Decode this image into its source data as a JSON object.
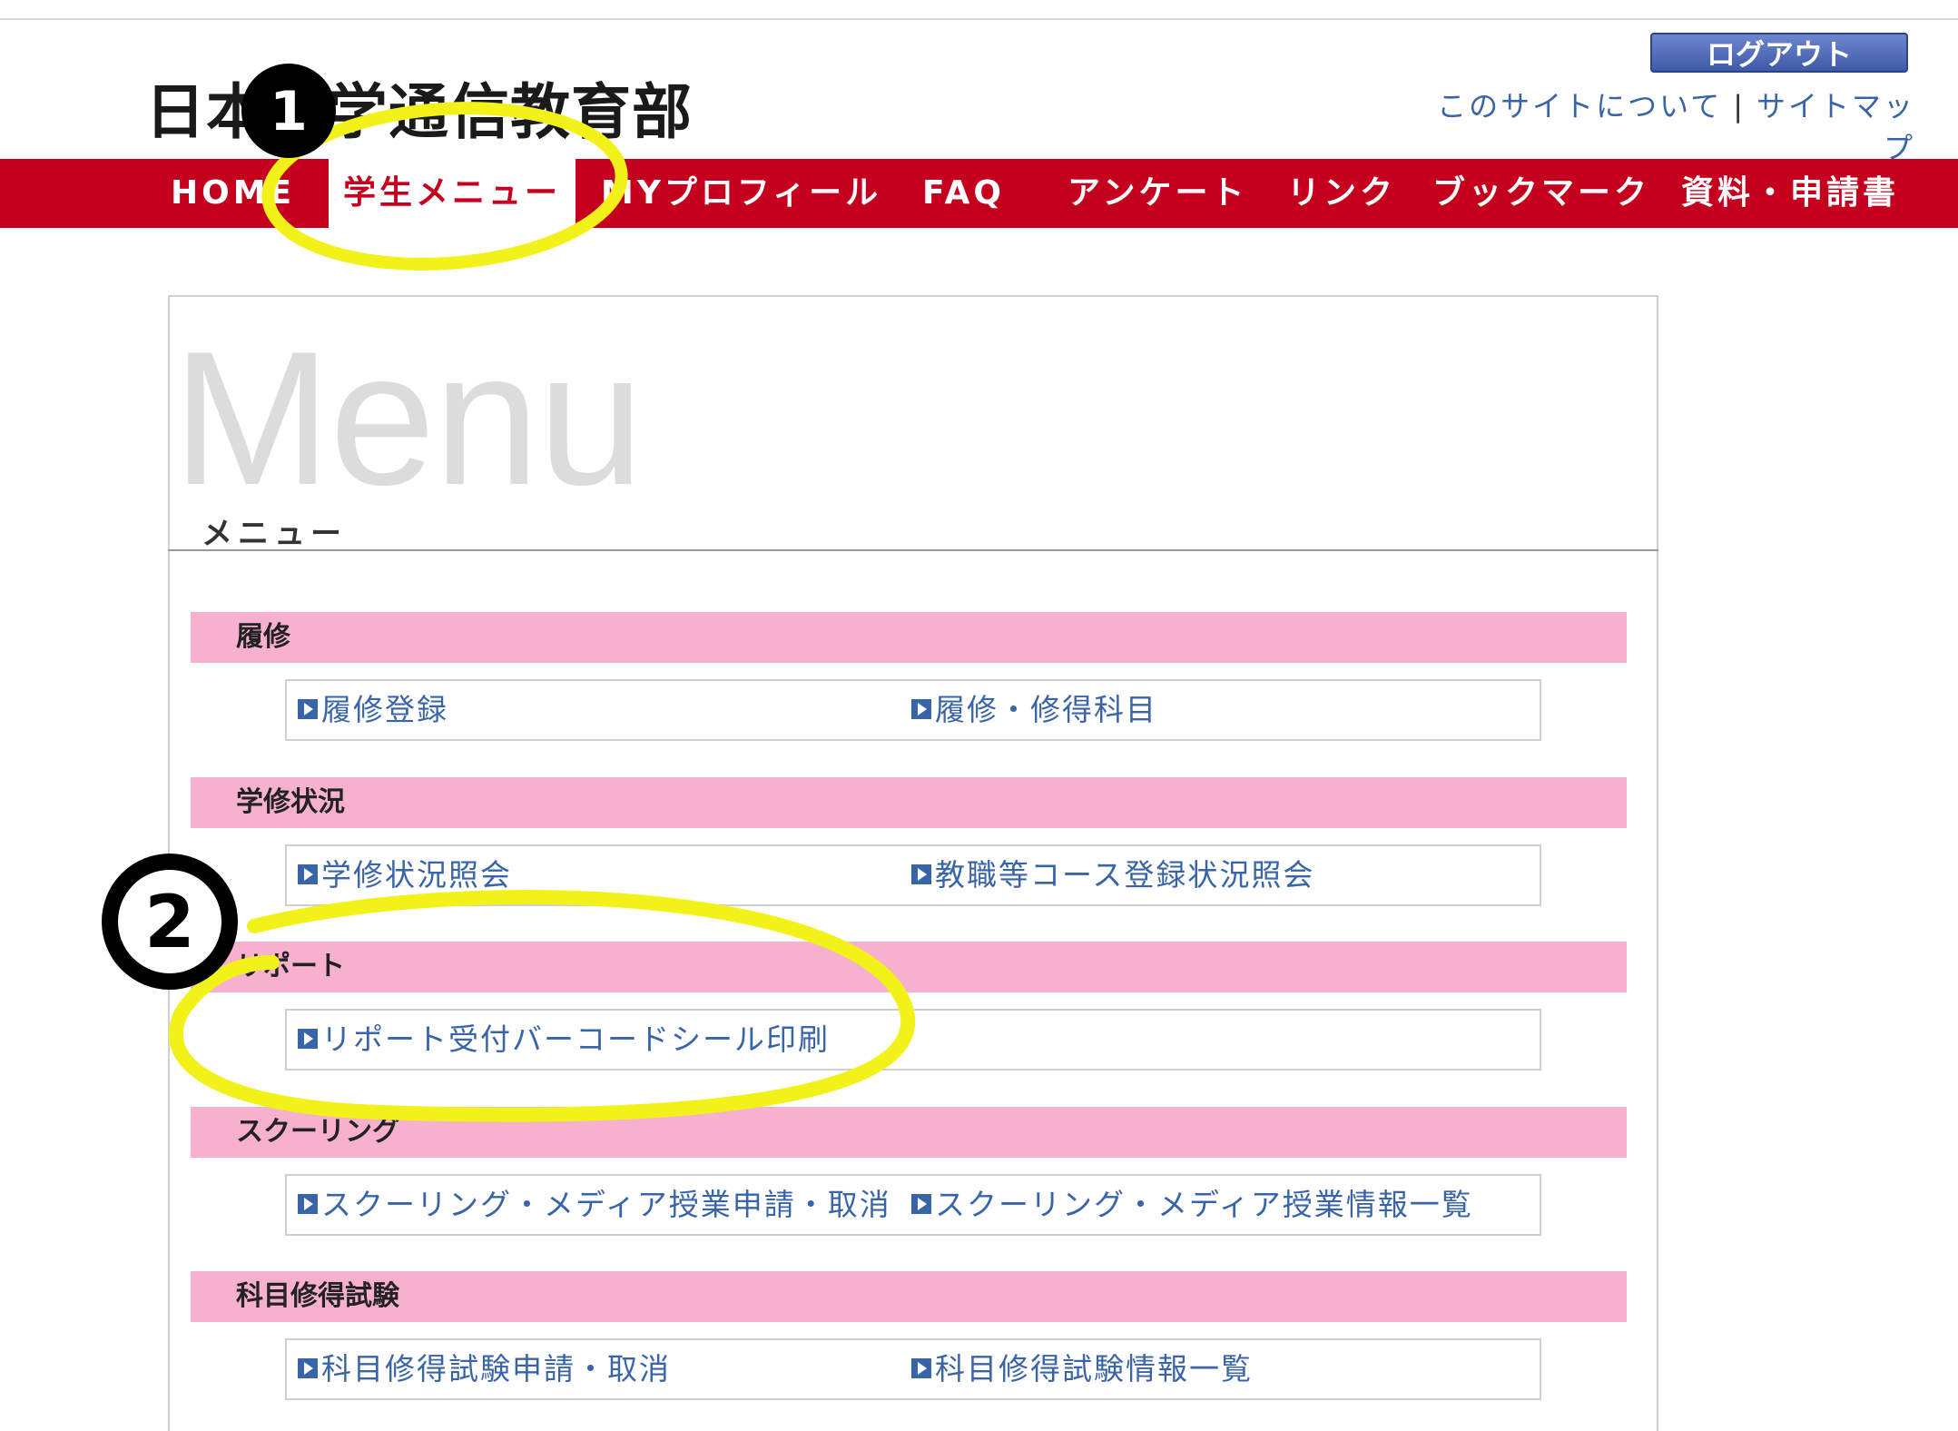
{
  "header": {
    "site_title": "日本大学通信教育部",
    "logout_label": "ログアウト",
    "about_label": "このサイトについて",
    "separator": "|",
    "sitemap_label": "サイトマップ"
  },
  "nav": {
    "items": [
      {
        "label": "HOME"
      },
      {
        "label": "学生メニュー",
        "active": true
      },
      {
        "label": "MYプロフィール"
      },
      {
        "label": "FAQ"
      },
      {
        "label": "アンケート"
      },
      {
        "label": "リンク"
      },
      {
        "label": "ブックマーク"
      },
      {
        "label": "資料・申請書"
      }
    ]
  },
  "menu": {
    "watermark": "Menu",
    "subtitle": "メニュー",
    "sections": [
      {
        "title": "履修",
        "links": [
          "履修登録",
          "履修・修得科目"
        ]
      },
      {
        "title": "学修状況",
        "links": [
          "学修状況照会",
          "教職等コース登録状況照会"
        ]
      },
      {
        "title": "リポート",
        "links": [
          "リポート受付バーコードシール印刷"
        ]
      },
      {
        "title": "スクーリング",
        "links": [
          "スクーリング・メディア授業申請・取消",
          "スクーリング・メディア授業情報一覧"
        ]
      },
      {
        "title": "科目修得試験",
        "links": [
          "科目修得試験申請・取消",
          "科目修得試験情報一覧"
        ]
      }
    ]
  },
  "annotations": {
    "marker_1": "1",
    "marker_2": "2",
    "highlight_color": "#f2f21a"
  },
  "colors": {
    "nav_red": "#c4001e",
    "section_pink": "#f7b0cd",
    "link_blue": "#3a64a8"
  }
}
